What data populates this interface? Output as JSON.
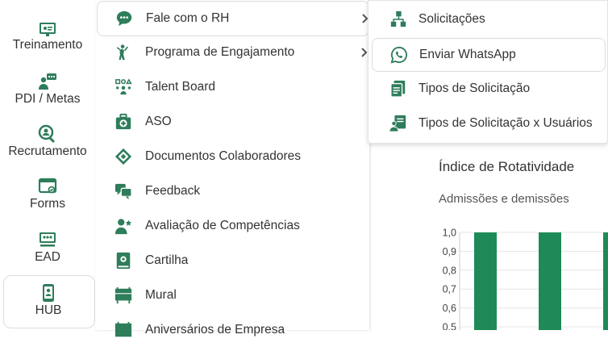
{
  "colors": {
    "accent": "#2e7d5b",
    "bar": "#1e8a57",
    "grid": "#e5e5e5"
  },
  "sidebar": {
    "items": [
      {
        "label": "Treinamento",
        "icon": "training-icon"
      },
      {
        "label": "PDI / Metas",
        "icon": "goals-icon"
      },
      {
        "label": "Recrutamento",
        "icon": "recruitment-icon"
      },
      {
        "label": "Forms",
        "icon": "forms-icon"
      },
      {
        "label": "EAD",
        "icon": "ead-icon"
      },
      {
        "label": "HUB",
        "icon": "hub-icon",
        "active": true
      }
    ]
  },
  "menu": {
    "items": [
      {
        "label": "Fale com o RH",
        "icon": "chat-icon",
        "has_submenu": true
      },
      {
        "label": "Programa de Engajamento",
        "icon": "engagement-icon",
        "has_submenu": true
      },
      {
        "label": "Talent Board",
        "icon": "talent-board-icon"
      },
      {
        "label": "ASO",
        "icon": "medical-kit-icon"
      },
      {
        "label": "Documentos Colaboradores",
        "icon": "documents-icon"
      },
      {
        "label": "Feedback",
        "icon": "feedback-icon"
      },
      {
        "label": "Avaliação de Competências",
        "icon": "competency-icon"
      },
      {
        "label": "Cartilha",
        "icon": "booklet-icon"
      },
      {
        "label": "Mural",
        "icon": "mural-icon"
      },
      {
        "label": "Aniversários de Empresa",
        "icon": "anniversary-icon"
      }
    ]
  },
  "submenu": {
    "items": [
      {
        "label": "Solicitações",
        "icon": "requests-icon"
      },
      {
        "label": "Enviar WhatsApp",
        "icon": "whatsapp-icon"
      },
      {
        "label": "Tipos de Solicitação",
        "icon": "request-types-icon"
      },
      {
        "label": "Tipos de Solicitação x Usuários",
        "icon": "request-types-users-icon"
      }
    ]
  },
  "chart": {
    "title": "Índice de Rotatividade",
    "subtitle": "Admissões e demissões"
  },
  "chart_data": {
    "type": "bar",
    "title": "Índice de Rotatividade",
    "subtitle": "Admissões e demissões",
    "y_ticks": [
      "1,0",
      "0,9",
      "0,8",
      "0,7",
      "0,6",
      "0,5"
    ],
    "values": [
      1.0,
      1.0,
      1.0
    ],
    "ylim": [
      0.5,
      1.0
    ],
    "grid": true
  }
}
